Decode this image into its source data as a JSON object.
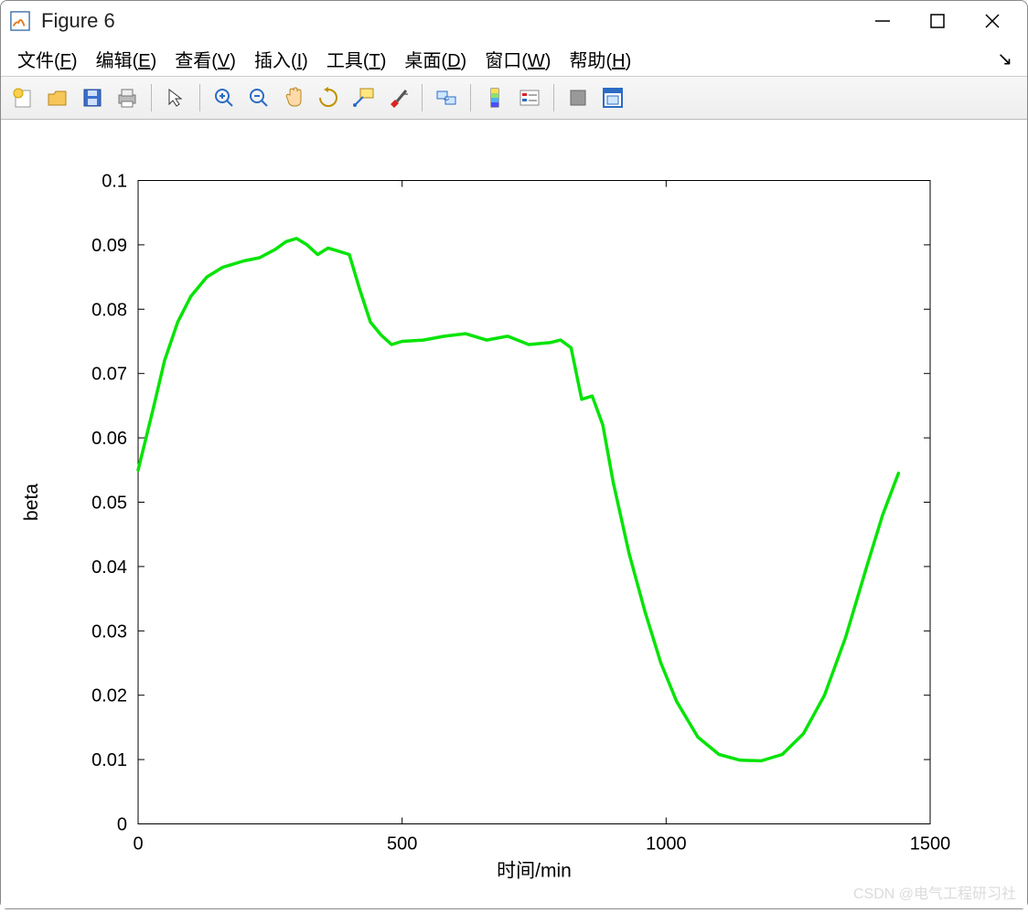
{
  "window": {
    "title": "Figure 6"
  },
  "menu": {
    "file": "文件",
    "file_key": "F",
    "edit": "编辑",
    "edit_key": "E",
    "view": "查看",
    "view_key": "V",
    "insert": "插入",
    "insert_key": "I",
    "tools": "工具",
    "tools_key": "T",
    "desktop": "桌面",
    "desktop_key": "D",
    "window_m": "窗口",
    "window_key": "W",
    "help": "帮助",
    "help_key": "H"
  },
  "toolbar_icons": {
    "new": "new-figure-icon",
    "open": "open-icon",
    "save": "save-icon",
    "print": "print-icon",
    "pointer": "pointer-icon",
    "zoom_in": "zoom-in-icon",
    "zoom_out": "zoom-out-icon",
    "pan": "pan-icon",
    "rotate": "rotate-icon",
    "datatip": "datatip-icon",
    "brush": "brush-icon",
    "link": "link-icon",
    "colorbar": "colorbar-icon",
    "legend": "legend-icon",
    "hide": "hide-tools-icon",
    "layout": "layout-icon"
  },
  "watermark": "CSDN @电气工程研习社",
  "chart_data": {
    "type": "line",
    "xlabel": "时间/min",
    "ylabel": "beta",
    "title": "",
    "xlim": [
      0,
      1500
    ],
    "ylim": [
      0,
      0.1
    ],
    "xticks": [
      0,
      500,
      1000,
      1500
    ],
    "yticks": [
      0,
      0.01,
      0.02,
      0.03,
      0.04,
      0.05,
      0.06,
      0.07,
      0.08,
      0.09,
      0.1
    ],
    "series": [
      {
        "name": "beta",
        "color": "#06e306",
        "x": [
          0,
          15,
          30,
          50,
          75,
          100,
          130,
          160,
          200,
          230,
          260,
          280,
          300,
          320,
          340,
          360,
          380,
          400,
          420,
          440,
          460,
          480,
          500,
          540,
          580,
          620,
          660,
          700,
          740,
          780,
          800,
          820,
          840,
          860,
          880,
          900,
          930,
          960,
          990,
          1020,
          1060,
          1100,
          1140,
          1180,
          1220,
          1260,
          1300,
          1340,
          1380,
          1410,
          1440
        ],
        "y": [
          0.055,
          0.06,
          0.065,
          0.072,
          0.078,
          0.082,
          0.085,
          0.0865,
          0.0875,
          0.088,
          0.0893,
          0.0905,
          0.091,
          0.09,
          0.0885,
          0.0895,
          0.089,
          0.0885,
          0.083,
          0.078,
          0.076,
          0.0745,
          0.075,
          0.0752,
          0.0758,
          0.0762,
          0.0752,
          0.0758,
          0.0745,
          0.0748,
          0.0752,
          0.074,
          0.066,
          0.0665,
          0.062,
          0.053,
          0.042,
          0.033,
          0.025,
          0.019,
          0.0135,
          0.0108,
          0.0099,
          0.0098,
          0.0108,
          0.014,
          0.02,
          0.029,
          0.04,
          0.048,
          0.0545
        ]
      }
    ]
  }
}
